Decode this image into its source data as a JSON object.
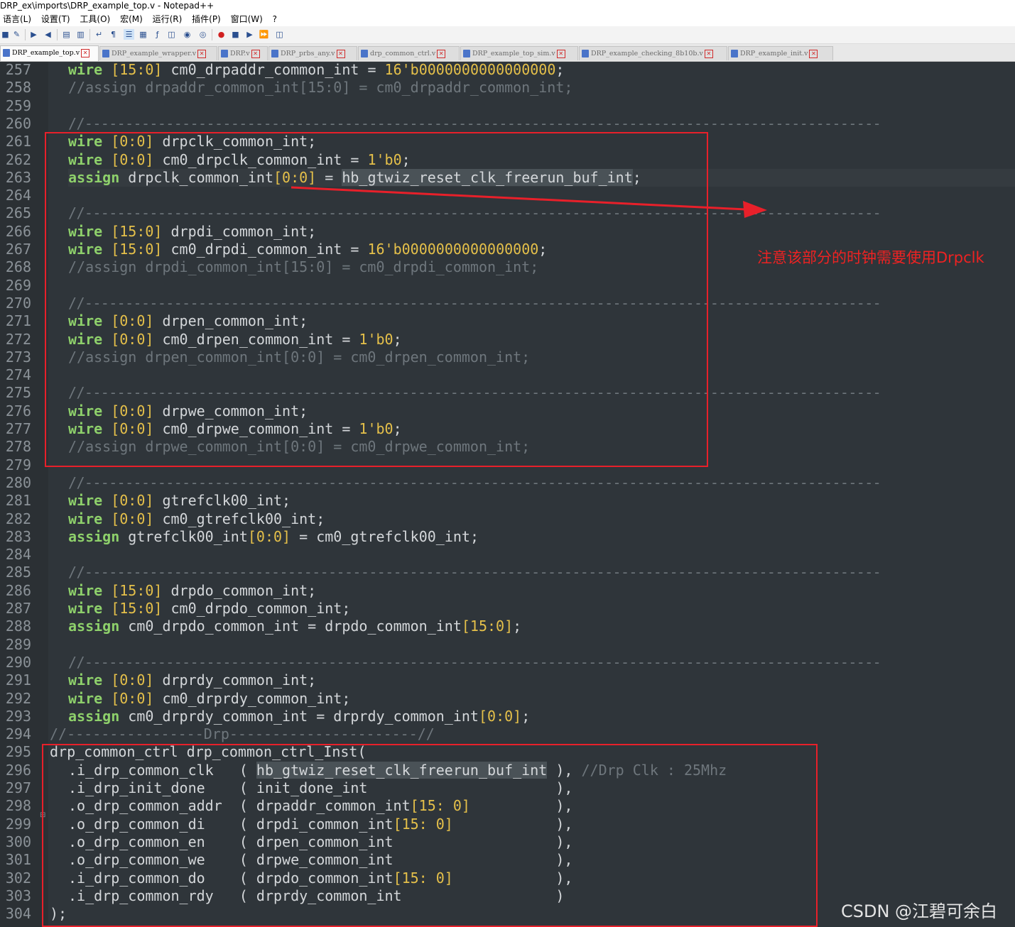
{
  "window": {
    "title": "DRP_ex\\imports\\DRP_example_top.v - Notepad++"
  },
  "menu": [
    "语言(L)",
    "设置(T)",
    "工具(O)",
    "宏(M)",
    "运行(R)",
    "插件(P)",
    "窗口(W)",
    "?"
  ],
  "toolbar_icons": [
    "lock-icon",
    "find-replace-icon",
    "zoom-in-icon",
    "zoom-out-icon",
    "sync-v-icon",
    "sync-h-icon",
    "word-wrap-icon",
    "show-all-chars-icon",
    "indent-guide-icon",
    "doc-map-icon",
    "function-list-icon",
    "folder-workspace-icon",
    "monitor-icon",
    "record-macro-icon",
    "stop-record-icon",
    "play-macro-icon",
    "run-macro-multiple-icon",
    "save-macro-icon"
  ],
  "tabs": [
    {
      "label": "DRP_example_top.v",
      "active": true
    },
    {
      "label": "DRP_example_wrapper.v",
      "active": false
    },
    {
      "label": "DRP.v",
      "active": false
    },
    {
      "label": "DRP_prbs_any.v",
      "active": false
    },
    {
      "label": "drp_common_ctrl.v",
      "active": false
    },
    {
      "label": "DRP_example_top_sim.v",
      "active": false
    },
    {
      "label": "DRP_example_checking_8b10b.v",
      "active": false
    },
    {
      "label": "DRP_example_init.v",
      "active": false
    }
  ],
  "editor": {
    "line_numbers": [
      "257",
      "258",
      "259",
      "260",
      "261",
      "262",
      "263",
      "264",
      "265",
      "266",
      "267",
      "268",
      "269",
      "270",
      "271",
      "272",
      "273",
      "274",
      "275",
      "276",
      "277",
      "278",
      "279",
      "280",
      "281",
      "282",
      "283",
      "284",
      "285",
      "286",
      "287",
      "288",
      "289",
      "290",
      "291",
      "292",
      "293",
      "294",
      "295",
      "296",
      "297",
      "298",
      "299",
      "300",
      "301",
      "302",
      "303",
      "304"
    ],
    "current_line": "263",
    "lines": [
      "wire [15:0] cm0_drpaddr_common_int = 16'b0000000000000000;",
      "//assign drpaddr_common_int[15:0] = cm0_drpaddr_common_int;",
      "",
      "//--------------------------------------------------------------------------------------------------",
      "wire [0:0] drpclk_common_int;",
      "wire [0:0] cm0_drpclk_common_int = 1'b0;",
      "assign drpclk_common_int[0:0] = hb_gtwiz_reset_clk_freerun_buf_int;",
      "",
      "//--------------------------------------------------------------------------------------------------",
      "wire [15:0] drpdi_common_int;",
      "wire [15:0] cm0_drpdi_common_int = 16'b0000000000000000;",
      "//assign drpdi_common_int[15:0] = cm0_drpdi_common_int;",
      "",
      "//--------------------------------------------------------------------------------------------------",
      "wire [0:0] drpen_common_int;",
      "wire [0:0] cm0_drpen_common_int = 1'b0;",
      "//assign drpen_common_int[0:0] = cm0_drpen_common_int;",
      "",
      "//--------------------------------------------------------------------------------------------------",
      "wire [0:0] drpwe_common_int;",
      "wire [0:0] cm0_drpwe_common_int = 1'b0;",
      "//assign drpwe_common_int[0:0] = cm0_drpwe_common_int;",
      "",
      "//--------------------------------------------------------------------------------------------------",
      "wire [0:0] gtrefclk00_int;",
      "wire [0:0] cm0_gtrefclk00_int;",
      "assign gtrefclk00_int[0:0] = cm0_gtrefclk00_int;",
      "",
      "//--------------------------------------------------------------------------------------------------",
      "wire [15:0] drpdo_common_int;",
      "wire [15:0] cm0_drpdo_common_int;",
      "assign cm0_drpdo_common_int = drpdo_common_int[15:0];",
      "",
      "//--------------------------------------------------------------------------------------------------",
      "wire [0:0] drprdy_common_int;",
      "wire [0:0] cm0_drprdy_common_int;",
      "assign cm0_drprdy_common_int = drprdy_common_int[0:0];",
      "//----------------Drp----------------------//",
      "drp_common_ctrl drp_common_ctrl_Inst(",
      ".i_drp_common_clk   ( hb_gtwiz_reset_clk_freerun_buf_int ), //Drp Clk : 25Mhz",
      ".i_drp_init_done    ( init_done_int                      ),",
      ".o_drp_common_addr  ( drpaddr_common_int[15: 0]          ),",
      ".o_drp_common_di    ( drpdi_common_int[15: 0]            ),",
      ".o_drp_common_en    ( drpen_common_int                   ),",
      ".o_drp_common_we    ( drpwe_common_int                   ),",
      ".i_drp_common_do    ( drpdo_common_int[15: 0]            ),",
      ".i_drp_common_rdy   ( drprdy_common_int                  )",
      ");"
    ]
  },
  "annotation": {
    "note": "注意该部分的时钟需要使用Drpclk",
    "color": "#ee2222"
  },
  "watermark": "CSDN @江碧可余白"
}
